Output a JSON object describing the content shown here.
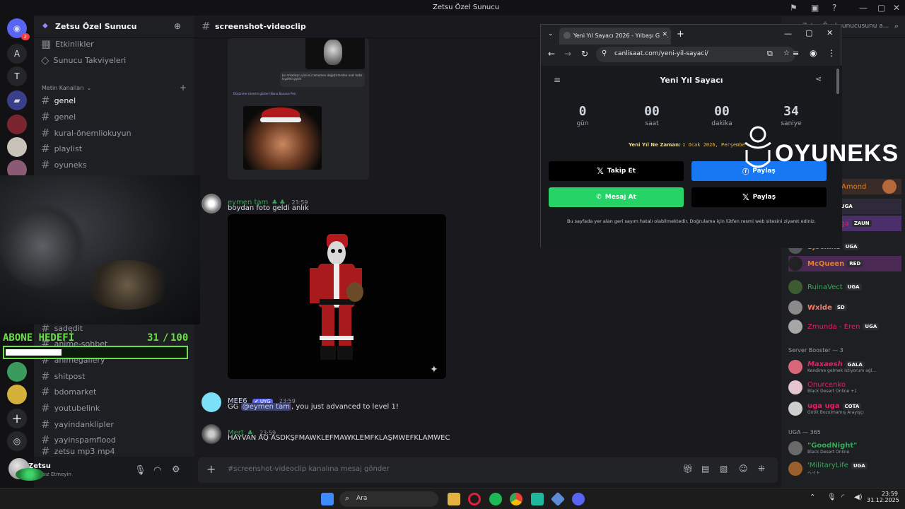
{
  "app": {
    "window_title": "Zetsu Özel Sunucu"
  },
  "server": {
    "name": "Zetsu Özel Sunucu",
    "top_items": [
      "Etkinlikler",
      "Sunucu Takviyeleri"
    ],
    "category": "Metin Kanalları",
    "channels": [
      "genel",
      "genel",
      "kural-önemliokuyun",
      "playlist",
      "oyuneks"
    ],
    "channels_lower": [
      "sadedit",
      "anime-sohbet",
      "animegallery",
      "shitpost",
      "bdomarket",
      "youtubelink",
      "yayindanklipler",
      "yayinspamflood",
      "zetsu mp3 mp4"
    ]
  },
  "guilds": {
    "badge": "2",
    "letters": [
      "A",
      "T"
    ]
  },
  "user": {
    "name": "Zetsu",
    "status": "Rahatsız Etmeyin"
  },
  "channel": {
    "name": "screenshot-videoclip",
    "search_placeholder": "Zetsu Özel sunucusunu a..."
  },
  "messages": [
    {
      "author": "eymen tam",
      "time": "23:59",
      "text": "boydan foto geldi anlık",
      "color": "#3ba55c"
    },
    {
      "author": "MEE6",
      "badge": "✔ UYG",
      "time": "23:59",
      "text_pre": "GG ",
      "mention": "@eymen tam",
      "text_post": ", you just advanced to level 1!",
      "color": "#c9d1ff"
    },
    {
      "author": "Mert",
      "time": "23:59",
      "text": "HAYVAN AQ ASDKŞFMAWKLEFMAWKLEMFKLAŞMWEFKLAMWEC",
      "color": "#3ba55c"
    }
  ],
  "embed_text": {
    "line1": "bu arkadaşın yüzünü tamamen değiştirmeden noel baba kıyafeti giydir",
    "line2": "Düşünme sürecini göster (Nano Banana Pro)"
  },
  "composer": {
    "placeholder": "#screenshot-videoclip kanalına mesaj gönder"
  },
  "overlay": {
    "label": "ABONE HEDEFİ",
    "current": "31",
    "goal": "100",
    "progress": 0.31
  },
  "browser": {
    "tab_title": "Yeni Yıl Sayacı 2026 - Yılbaşı Ge...",
    "url": "canlisaat.com/yeni-yil-sayaci/",
    "page_title": "Yeni Yıl Sayacı",
    "counters": [
      {
        "value": "0",
        "label": "gün"
      },
      {
        "value": "00",
        "label": "saat"
      },
      {
        "value": "00",
        "label": "dakika"
      },
      {
        "value": "34",
        "label": "saniye"
      }
    ],
    "when_label": "Yeni Yıl Ne Zaman:",
    "when_value": "1 Ocak 2026, Perşembe",
    "buttons": {
      "follow": "Takip Et",
      "share_fb": "Paylaş",
      "whatsapp": "Mesaj At",
      "share_x": "Paylaş"
    },
    "disclaimer": "Bu sayfada yer alan geri sayım hatalı olabilmektedir. Doğrulama için lütfen resmi web sitesini ziyaret ediniz."
  },
  "watermark": {
    "text": "OYUNEKS"
  },
  "members": {
    "list": [
      {
        "name": "Amond",
        "color": "#e67e22"
      },
      {
        "name": "",
        "tag": "UGA"
      },
      {
        "name": "uga",
        "tag": "ZAUN",
        "color": "#e91e63"
      },
      {
        "name": "Sjockins",
        "tag": "UGA",
        "color": "#e67e22"
      },
      {
        "name": "McQueen",
        "tag": "RED",
        "color": "#e67e22"
      },
      {
        "name": "RuinaVect",
        "tag": "UGA",
        "color": "#3ba55c"
      },
      {
        "name": "Wxlde",
        "tag": "SD",
        "color": "#f47b67"
      },
      {
        "name": "Zmunda - Eren",
        "tag": "UGA",
        "color": "#e91e63"
      }
    ],
    "booster_header": "Server Booster — 3",
    "boosters": [
      {
        "name": "Maxaesh",
        "tag": "GALA",
        "sub": "Kendime gelmek istiyorum ağl...",
        "color": "#e91e63"
      },
      {
        "name": "Onurcenko",
        "sub": "Black Desert Online +1",
        "color": "#e91e63"
      },
      {
        "name": "uga uga",
        "tag": "COTA",
        "sub": "Gotik Bozulmamış Arayışçı",
        "color": "#e91e63"
      }
    ],
    "uga_header": "UGA — 365",
    "uga": [
      {
        "name": "\"GoodNight\"",
        "sub": "Black Desert Online",
        "color": "#3ba55c"
      },
      {
        "name": "'MilitaryLife",
        "tag": "UGA",
        "sub": "ヘイト",
        "color": "#3ba55c"
      }
    ]
  },
  "taskbar": {
    "search": "Ara",
    "time": "23:59",
    "date": "31.12.2025"
  }
}
